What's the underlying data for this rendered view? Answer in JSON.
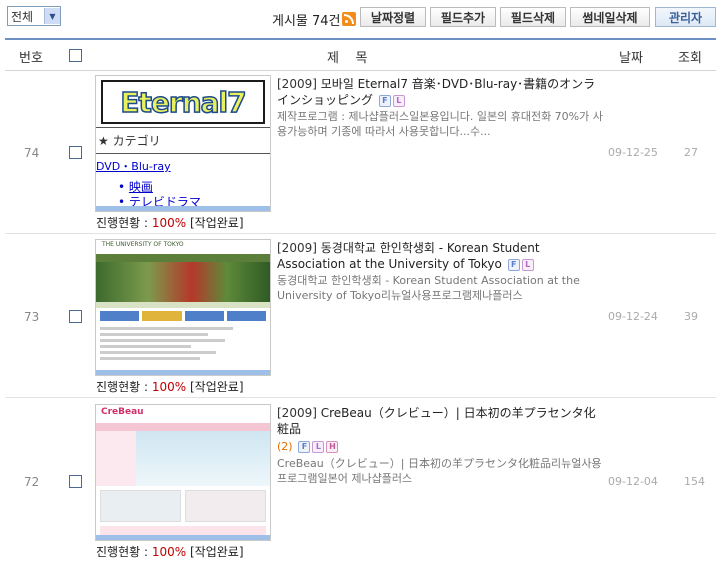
{
  "toolbar": {
    "filter_value": "전체",
    "count_label": "게시물 74건",
    "buttons": {
      "sort_date": "날짜정렬",
      "add_field": "필드추가",
      "delete_field": "필드삭제",
      "delete_thumb": "썸네일삭제",
      "admin": "관리자"
    }
  },
  "columns": {
    "num": "번호",
    "title": "제    목",
    "date": "날짜",
    "views": "조회"
  },
  "rows": [
    {
      "num": "74",
      "year": "[2009]",
      "title": "모바일 Eternal7 音楽･DVD･Blu-ray･書籍のオンラインショッピング",
      "comments": "",
      "badges": [
        "F",
        "L"
      ],
      "desc": "제작프로그램 : 제나샵플러스일본용입니다. 일본의 휴대전화 70%가 사용가능하며 기종에 따라서 사용못합니다...수...",
      "date": "09-12-25",
      "views": "27",
      "progress_label": "진행현황 : ",
      "progress_pct": "100%",
      "progress_status": " [작업완료]",
      "thumb": {
        "logo": "Eternal7",
        "category": "★ カテゴリ",
        "link": "DVD・Blu-ray",
        "items": [
          "映画",
          "テレビドラマ"
        ]
      }
    },
    {
      "num": "73",
      "year": "[2009]",
      "title": "동경대학교 한인학생회 - Korean Student Association at the University of Tokyo",
      "comments": "",
      "badges": [
        "F",
        "L"
      ],
      "desc": "동경대학교 한인학생회 - Korean Student Association at the University of Tokyo리뉴얼사용프로그램제나플러스",
      "date": "09-12-24",
      "views": "39",
      "progress_label": "진행현황 : ",
      "progress_pct": "100%",
      "progress_status": " [작업완료]",
      "thumb": {
        "logo": "THE UNIVERSITY OF TOKYO"
      }
    },
    {
      "num": "72",
      "year": "[2009]",
      "title": "CreBeau（クレビュー）| 日本初の羊プラセンタ化粧品",
      "comments": "(2)",
      "badges": [
        "F",
        "L",
        "H"
      ],
      "desc": "CreBeau（クレビュー）| 日本初の羊プラセンタ化粧品리뉴얼사용프로그램일본어 제나샵플러스",
      "date": "09-12-04",
      "views": "154",
      "progress_label": "진행현황 : ",
      "progress_pct": "100%",
      "progress_status": " [작업완료]",
      "thumb": {
        "logo": "CreBeau"
      }
    }
  ]
}
